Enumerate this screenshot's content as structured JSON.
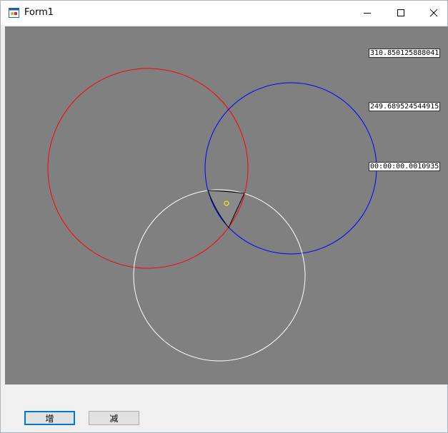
{
  "window": {
    "title": "Form1"
  },
  "readouts": {
    "value1": "310.850125888041",
    "value2": "249.689524544915",
    "elapsed": "00:00:00.0010935"
  },
  "buttons": {
    "increase": "增",
    "decrease": "减"
  },
  "colors": {
    "canvas_bg": "#808080",
    "circle_red": "#ff0000",
    "circle_blue": "#0000ff",
    "circle_white": "#ffffff",
    "marker": "#ffff00"
  },
  "icons": [
    "form-app-icon",
    "minimize-icon",
    "maximize-icon",
    "close-icon"
  ]
}
